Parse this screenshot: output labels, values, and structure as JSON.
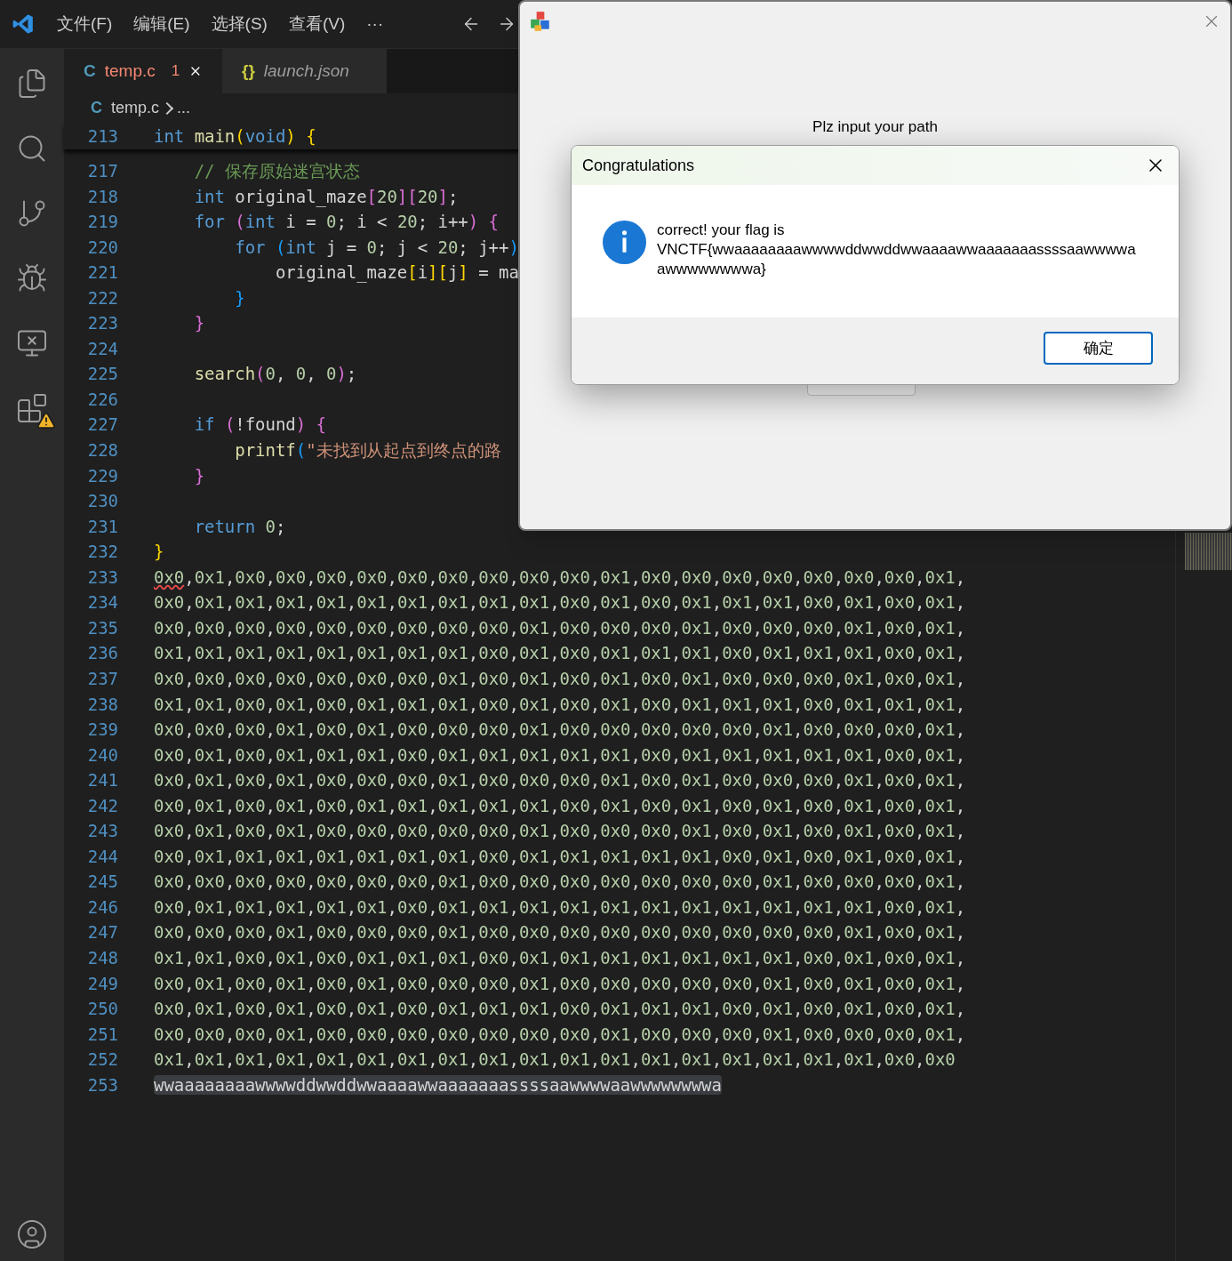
{
  "menu": [
    "文件(F)",
    "编辑(E)",
    "选择(S)",
    "查看(V)",
    "···"
  ],
  "activity": [
    {
      "kind": "files",
      "selected": false,
      "warning": false
    },
    {
      "kind": "search",
      "selected": false,
      "warning": false
    },
    {
      "kind": "scm",
      "selected": false,
      "warning": false
    },
    {
      "kind": "debug",
      "selected": false,
      "warning": false
    },
    {
      "kind": "remote",
      "selected": false,
      "warning": false
    },
    {
      "kind": "extensions",
      "selected": false,
      "warning": true
    }
  ],
  "tabs": [
    {
      "icon": "C",
      "label": "temp.c",
      "problems": "1",
      "selected": true,
      "italic": false
    },
    {
      "icon": "{}",
      "label": "launch.json",
      "selected": false,
      "italic": true
    }
  ],
  "breadcrumb": {
    "icon": "C",
    "file": "temp.c",
    "rest": "..."
  },
  "sticky": {
    "number": "213",
    "tokens": [
      {
        "text": "int",
        "kind": "keyword"
      },
      {
        "text": " main",
        "kind": "func"
      },
      {
        "text": "(",
        "kind": "b1"
      },
      {
        "text": "void",
        "kind": "keyword"
      },
      {
        "text": ")",
        "kind": "b1"
      },
      {
        "text": " {",
        "kind": "b1"
      }
    ]
  },
  "lines": [
    {
      "number": "217",
      "tokens": [
        {
          "text": "    // 保存原始迷宫状态",
          "kind": "comment"
        }
      ]
    },
    {
      "number": "218",
      "tokens": [
        {
          "text": "    int",
          "kind": "keyword"
        },
        {
          "text": " original_maze",
          "kind": "plain"
        },
        {
          "text": "[",
          "kind": "b2"
        },
        {
          "text": "20",
          "kind": "number"
        },
        {
          "text": "][",
          "kind": "b2"
        },
        {
          "text": "20",
          "kind": "number"
        },
        {
          "text": "]",
          "kind": "b2"
        },
        {
          "text": ";",
          "kind": "plain"
        }
      ]
    },
    {
      "number": "219",
      "tokens": [
        {
          "text": "    for",
          "kind": "keyword"
        },
        {
          "text": " (",
          "kind": "b2"
        },
        {
          "text": "int",
          "kind": "keyword"
        },
        {
          "text": " i = ",
          "kind": "plain"
        },
        {
          "text": "0",
          "kind": "number"
        },
        {
          "text": "; i < ",
          "kind": "plain"
        },
        {
          "text": "20",
          "kind": "number"
        },
        {
          "text": "; i++",
          "kind": "plain"
        },
        {
          "text": ")",
          "kind": "b2"
        },
        {
          "text": " {",
          "kind": "b2"
        }
      ]
    },
    {
      "number": "220",
      "tokens": [
        {
          "text": "        for",
          "kind": "keyword"
        },
        {
          "text": " (",
          "kind": "b3"
        },
        {
          "text": "int",
          "kind": "keyword"
        },
        {
          "text": " j = ",
          "kind": "plain"
        },
        {
          "text": "0",
          "kind": "number"
        },
        {
          "text": "; j < ",
          "kind": "plain"
        },
        {
          "text": "20",
          "kind": "number"
        },
        {
          "text": "; j++",
          "kind": "plain"
        },
        {
          "text": ")",
          "kind": "b3"
        }
      ]
    },
    {
      "number": "221",
      "tokens": [
        {
          "text": "            original_maze",
          "kind": "plain"
        },
        {
          "text": "[",
          "kind": "b1"
        },
        {
          "text": "i",
          "kind": "plain"
        },
        {
          "text": "][",
          "kind": "b1"
        },
        {
          "text": "j",
          "kind": "plain"
        },
        {
          "text": "]",
          "kind": "b1"
        },
        {
          "text": " = ma",
          "kind": "plain"
        }
      ]
    },
    {
      "number": "222",
      "tokens": [
        {
          "text": "        }",
          "kind": "b3"
        }
      ]
    },
    {
      "number": "223",
      "tokens": [
        {
          "text": "    }",
          "kind": "b2"
        }
      ]
    },
    {
      "number": "224"
    },
    {
      "number": "225",
      "tokens": [
        {
          "text": "    search",
          "kind": "func"
        },
        {
          "text": "(",
          "kind": "b2"
        },
        {
          "text": "0",
          "kind": "number"
        },
        {
          "text": ", ",
          "kind": "plain"
        },
        {
          "text": "0",
          "kind": "number"
        },
        {
          "text": ", ",
          "kind": "plain"
        },
        {
          "text": "0",
          "kind": "number"
        },
        {
          "text": ")",
          "kind": "b2"
        },
        {
          "text": ";",
          "kind": "plain"
        }
      ]
    },
    {
      "number": "226"
    },
    {
      "number": "227",
      "tokens": [
        {
          "text": "    if",
          "kind": "keyword"
        },
        {
          "text": " (",
          "kind": "b2"
        },
        {
          "text": "!found",
          "kind": "plain"
        },
        {
          "text": ")",
          "kind": "b2"
        },
        {
          "text": " {",
          "kind": "b2"
        }
      ]
    },
    {
      "number": "228",
      "tokens": [
        {
          "text": "        printf",
          "kind": "func"
        },
        {
          "text": "(",
          "kind": "b3"
        },
        {
          "text": "\"未找到从起点到终点的路",
          "kind": "string"
        }
      ]
    },
    {
      "number": "229",
      "tokens": [
        {
          "text": "    }",
          "kind": "b2"
        }
      ]
    },
    {
      "number": "230"
    },
    {
      "number": "231",
      "tokens": [
        {
          "text": "    return",
          "kind": "keyword"
        },
        {
          "text": " 0",
          "kind": "number"
        },
        {
          "text": ";",
          "kind": "plain"
        }
      ]
    },
    {
      "number": "232",
      "tokens": [
        {
          "text": "}",
          "kind": "b1"
        }
      ]
    },
    {
      "number": "233",
      "tokens": [
        {
          "text": "0x0",
          "kind": "error"
        },
        {
          "text": ",0x1,0x0,0x0,0x0,0x0,0x0,0x0,0x0,0x0,0x0,0x1,0x0,0x0,0x0,0x0,0x0,0x0,0x0,0x1,",
          "kind": "hexlist"
        }
      ]
    },
    {
      "number": "234",
      "tokens": [
        {
          "text": "0x0,0x1,0x1,0x1,0x1,0x1,0x1,0x1,0x1,0x1,0x0,0x1,0x0,0x1,0x1,0x1,0x0,0x1,0x0,0x1,",
          "kind": "hexlist"
        }
      ]
    },
    {
      "number": "235",
      "tokens": [
        {
          "text": "0x0,0x0,0x0,0x0,0x0,0x0,0x0,0x0,0x0,0x1,0x0,0x0,0x0,0x1,0x0,0x0,0x0,0x1,0x0,0x1,",
          "kind": "hexlist"
        }
      ]
    },
    {
      "number": "236",
      "tokens": [
        {
          "text": "0x1,0x1,0x1,0x1,0x1,0x1,0x1,0x1,0x0,0x1,0x0,0x1,0x1,0x1,0x0,0x1,0x1,0x1,0x0,0x1,",
          "kind": "hexlist"
        }
      ]
    },
    {
      "number": "237",
      "tokens": [
        {
          "text": "0x0,0x0,0x0,0x0,0x0,0x0,0x0,0x1,0x0,0x1,0x0,0x1,0x0,0x1,0x0,0x0,0x0,0x1,0x0,0x1,",
          "kind": "hexlist"
        }
      ]
    },
    {
      "number": "238",
      "tokens": [
        {
          "text": "0x1,0x1,0x0,0x1,0x0,0x1,0x1,0x1,0x0,0x1,0x0,0x1,0x0,0x1,0x1,0x1,0x0,0x1,0x1,0x1,",
          "kind": "hexlist"
        }
      ]
    },
    {
      "number": "239",
      "tokens": [
        {
          "text": "0x0,0x0,0x0,0x1,0x0,0x1,0x0,0x0,0x0,0x1,0x0,0x0,0x0,0x0,0x0,0x1,0x0,0x0,0x0,0x1,",
          "kind": "hexlist"
        }
      ]
    },
    {
      "number": "240",
      "tokens": [
        {
          "text": "0x0,0x1,0x0,0x1,0x1,0x1,0x0,0x1,0x1,0x1,0x1,0x1,0x0,0x1,0x1,0x1,0x1,0x1,0x0,0x1,",
          "kind": "hexlist"
        }
      ]
    },
    {
      "number": "241",
      "tokens": [
        {
          "text": "0x0,0x1,0x0,0x1,0x0,0x0,0x0,0x1,0x0,0x0,0x0,0x1,0x0,0x1,0x0,0x0,0x0,0x1,0x0,0x1,",
          "kind": "hexlist"
        }
      ]
    },
    {
      "number": "242",
      "tokens": [
        {
          "text": "0x0,0x1,0x0,0x1,0x0,0x1,0x1,0x1,0x1,0x1,0x0,0x1,0x0,0x1,0x0,0x1,0x0,0x1,0x0,0x1,",
          "kind": "hexlist"
        }
      ]
    },
    {
      "number": "243",
      "tokens": [
        {
          "text": "0x0,0x1,0x0,0x1,0x0,0x0,0x0,0x0,0x0,0x1,0x0,0x0,0x0,0x1,0x0,0x1,0x0,0x1,0x0,0x1,",
          "kind": "hexlist"
        }
      ]
    },
    {
      "number": "244",
      "tokens": [
        {
          "text": "0x0,0x1,0x1,0x1,0x1,0x1,0x1,0x1,0x0,0x1,0x1,0x1,0x1,0x1,0x0,0x1,0x0,0x1,0x0,0x1,",
          "kind": "hexlist"
        }
      ]
    },
    {
      "number": "245",
      "tokens": [
        {
          "text": "0x0,0x0,0x0,0x0,0x0,0x0,0x0,0x1,0x0,0x0,0x0,0x0,0x0,0x0,0x0,0x1,0x0,0x0,0x0,0x1,",
          "kind": "hexlist"
        }
      ]
    },
    {
      "number": "246",
      "tokens": [
        {
          "text": "0x0,0x1,0x1,0x1,0x1,0x1,0x0,0x1,0x1,0x1,0x1,0x1,0x1,0x1,0x1,0x1,0x1,0x1,0x0,0x1,",
          "kind": "hexlist"
        }
      ]
    },
    {
      "number": "247",
      "tokens": [
        {
          "text": "0x0,0x0,0x0,0x1,0x0,0x0,0x0,0x1,0x0,0x0,0x0,0x0,0x0,0x0,0x0,0x0,0x0,0x1,0x0,0x1,",
          "kind": "hexlist"
        }
      ]
    },
    {
      "number": "248",
      "tokens": [
        {
          "text": "0x1,0x1,0x0,0x1,0x0,0x1,0x1,0x1,0x0,0x1,0x1,0x1,0x1,0x1,0x1,0x1,0x0,0x1,0x0,0x1,",
          "kind": "hexlist"
        }
      ]
    },
    {
      "number": "249",
      "tokens": [
        {
          "text": "0x0,0x1,0x0,0x1,0x0,0x1,0x0,0x0,0x0,0x1,0x0,0x0,0x0,0x0,0x0,0x1,0x0,0x1,0x0,0x1,",
          "kind": "hexlist"
        }
      ]
    },
    {
      "number": "250",
      "tokens": [
        {
          "text": "0x0,0x1,0x0,0x1,0x0,0x1,0x0,0x1,0x1,0x1,0x0,0x1,0x1,0x1,0x0,0x1,0x0,0x1,0x0,0x1,",
          "kind": "hexlist"
        }
      ]
    },
    {
      "number": "251",
      "tokens": [
        {
          "text": "0x0,0x0,0x0,0x1,0x0,0x0,0x0,0x0,0x0,0x0,0x0,0x1,0x0,0x0,0x0,0x1,0x0,0x0,0x0,0x1,",
          "kind": "hexlist"
        }
      ]
    },
    {
      "number": "252",
      "tokens": [
        {
          "text": "0x1,0x1,0x1,0x1,0x1,0x1,0x1,0x1,0x1,0x1,0x1,0x1,0x1,0x1,0x1,0x1,0x1,0x1,0x0,0x0",
          "kind": "hexlist"
        }
      ]
    },
    {
      "number": "253",
      "tokens": [
        {
          "text": "wwaaaaaaaawwwwddwwddwwaaaawwaaaaaaassssaawwwwaawwwwwwwwa",
          "kind": "selected"
        }
      ]
    }
  ],
  "app_window": {
    "label": "Plz input your path"
  },
  "message_box": {
    "title": "Congratulations",
    "kind": "info",
    "lines": [
      "correct! your flag is",
      "VNCTF{wwaaaaaaaawwwwddwwddwwaaaawwaaaaaaassssaawwwwa",
      "awwwwwwwwa}"
    ],
    "button": "确定"
  }
}
